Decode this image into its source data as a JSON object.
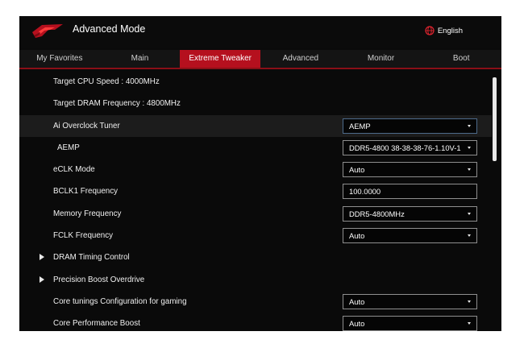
{
  "header": {
    "title": "Advanced Mode",
    "language": "English",
    "logo_icon": "rog-eye-logo",
    "accent_color": "#b5101e"
  },
  "tabs": [
    {
      "label": "My Favorites",
      "active": false
    },
    {
      "label": "Main",
      "active": false
    },
    {
      "label": "Extreme Tweaker",
      "active": true
    },
    {
      "label": "Advanced",
      "active": false
    },
    {
      "label": "Monitor",
      "active": false
    },
    {
      "label": "Boot",
      "active": false
    }
  ],
  "rows": {
    "target_cpu": {
      "label": "Target CPU Speed : 4000MHz"
    },
    "target_dram": {
      "label": "Target DRAM Frequency : 4800MHz"
    },
    "ai_overclock": {
      "label": "Ai Overclock Tuner",
      "value": "AEMP"
    },
    "aemp": {
      "label": "AEMP",
      "value": "DDR5-4800 38-38-38-76-1.10V-1"
    },
    "eclk_mode": {
      "label": "eCLK Mode",
      "value": "Auto"
    },
    "bclk1": {
      "label": "BCLK1 Frequency",
      "value": "100.0000"
    },
    "memory_freq": {
      "label": "Memory Frequency",
      "value": "DDR5-4800MHz"
    },
    "fclk_freq": {
      "label": "FCLK Frequency",
      "value": "Auto"
    },
    "dram_timing": {
      "label": "DRAM Timing Control"
    },
    "pbo": {
      "label": "Precision Boost Overdrive"
    },
    "core_tunings": {
      "label": "Core tunings Configuration for gaming",
      "value": "Auto"
    },
    "core_perf_boost": {
      "label": "Core Performance Boost",
      "value": "Auto"
    }
  },
  "scrollbar": {
    "position_fraction": 0.0
  }
}
